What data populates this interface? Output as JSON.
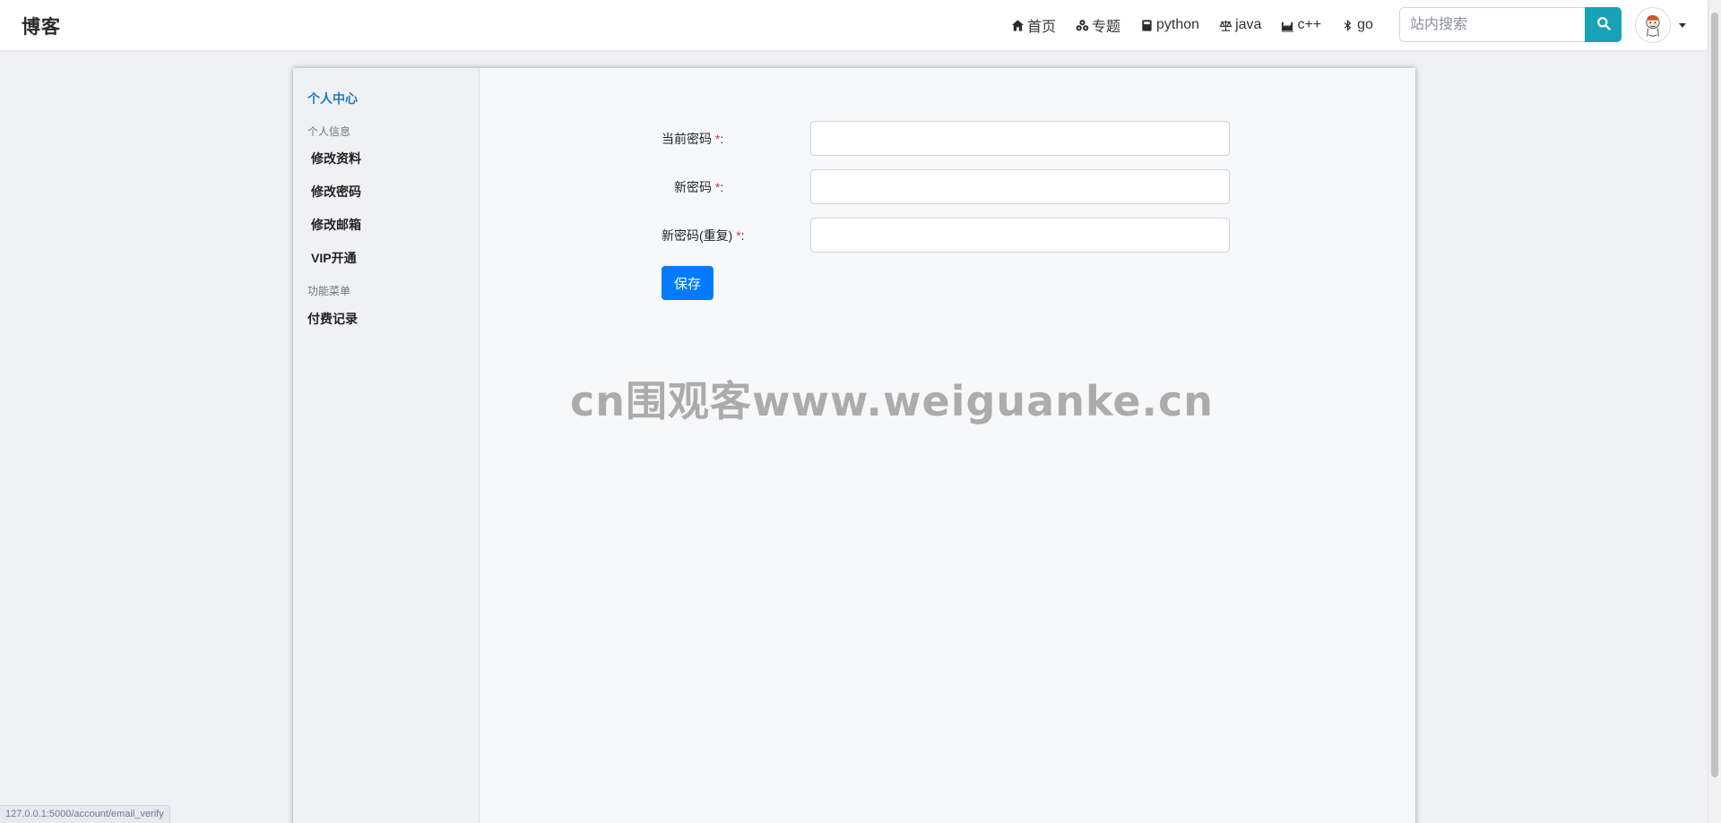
{
  "navbar": {
    "brand": "博客",
    "links": [
      {
        "label": "首页",
        "icon": "home-icon"
      },
      {
        "label": "专题",
        "icon": "cubes-icon"
      },
      {
        "label": "python",
        "icon": "book-icon"
      },
      {
        "label": "java",
        "icon": "balance-scale-icon"
      },
      {
        "label": "c++",
        "icon": "industry-icon"
      },
      {
        "label": "go",
        "icon": "bluetooth-icon"
      }
    ],
    "search": {
      "placeholder": "站内搜索",
      "value": ""
    }
  },
  "sidebar": {
    "title": "个人中心",
    "section_personal": "个人信息",
    "items_personal": [
      "修改资料",
      "修改密码",
      "修改邮箱",
      "VIP开通"
    ],
    "section_functions": "功能菜单",
    "items_functions": [
      "付费记录"
    ]
  },
  "form": {
    "current_password_label": "当前密码",
    "new_password_label": "新密码",
    "confirm_password_label": "新密码(重复)",
    "required_mark": "*",
    "colon": ":",
    "save_label": "保存"
  },
  "watermark": "cn围观客www.weiguanke.cn",
  "status_url": "127.0.0.1:5000/account/email_verify",
  "colors": {
    "accent_blue": "#007bff",
    "search_button": "#17a2b8",
    "sidebar_title": "#1a7bc4",
    "required": "#dc3545"
  }
}
